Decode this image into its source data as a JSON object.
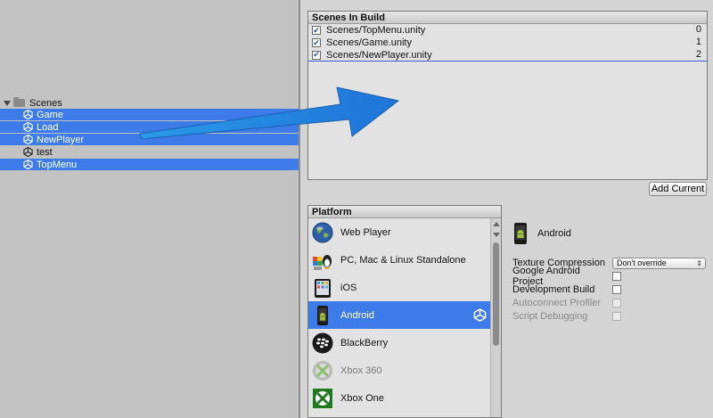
{
  "project": {
    "folder_label": "Scenes",
    "items": [
      {
        "label": "Game",
        "selected": true
      },
      {
        "label": "Load",
        "selected": true
      },
      {
        "label": "NewPlayer",
        "selected": true
      },
      {
        "label": "test",
        "selected": false
      },
      {
        "label": "TopMenu",
        "selected": true
      }
    ]
  },
  "scenes_in_build": {
    "title": "Scenes In Build",
    "scenes": [
      {
        "path": "Scenes/TopMenu.unity",
        "index": "0",
        "checked": true
      },
      {
        "path": "Scenes/Game.unity",
        "index": "1",
        "checked": true
      },
      {
        "path": "Scenes/NewPlayer.unity",
        "index": "2",
        "checked": true
      }
    ],
    "add_current_label": "Add Current"
  },
  "platform_list": {
    "title": "Platform",
    "items": [
      {
        "label": "Web Player",
        "icon": "web-player-icon"
      },
      {
        "label": "PC, Mac & Linux Standalone",
        "icon": "standalone-icon"
      },
      {
        "label": "iOS",
        "icon": "ios-icon"
      },
      {
        "label": "Android",
        "icon": "android-icon",
        "selected": true
      },
      {
        "label": "BlackBerry",
        "icon": "blackberry-icon"
      },
      {
        "label": "Xbox 360",
        "icon": "xbox360-icon",
        "dim": true
      },
      {
        "label": "Xbox One",
        "icon": "xbox-one-icon"
      }
    ]
  },
  "platform_settings": {
    "platform_name": "Android",
    "texture_compression_label": "Texture Compression",
    "texture_compression_value": "Don't override",
    "google_android_project_label": "Google Android Project",
    "development_build_label": "Development Build",
    "autoconnect_profiler_label": "Autoconnect Profiler",
    "script_debugging_label": "Script Debugging"
  },
  "colors": {
    "selection": "#3d7ce8",
    "arrow": "#1e8ae6"
  }
}
